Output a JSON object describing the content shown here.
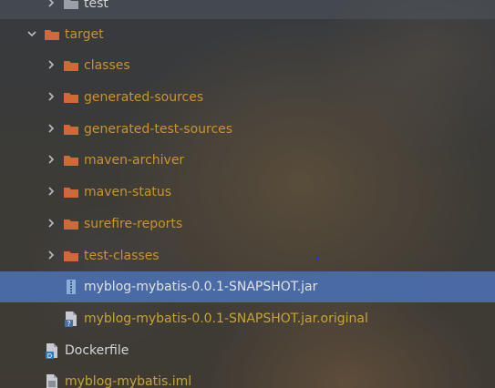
{
  "tree": {
    "top_item": {
      "label": "test"
    },
    "target": {
      "label": "target"
    },
    "target_children": [
      {
        "label": "classes"
      },
      {
        "label": "generated-sources"
      },
      {
        "label": "generated-test-sources"
      },
      {
        "label": "maven-archiver"
      },
      {
        "label": "maven-status"
      },
      {
        "label": "surefire-reports"
      },
      {
        "label": "test-classes"
      }
    ],
    "jar_file": {
      "label": "myblog-mybatis-0.0.1-SNAPSHOT.jar",
      "selected": true
    },
    "jar_original": {
      "label": "myblog-mybatis-0.0.1-SNAPSHOT.jar.original"
    },
    "dockerfile": {
      "label": "Dockerfile"
    },
    "iml_file": {
      "label": "myblog-mybatis.iml"
    }
  },
  "colors": {
    "selection": "#4b6eaf",
    "excluded_folder_text": "#c9932e",
    "folder_icon": "#d0683a",
    "hover_row": "#50555c"
  }
}
